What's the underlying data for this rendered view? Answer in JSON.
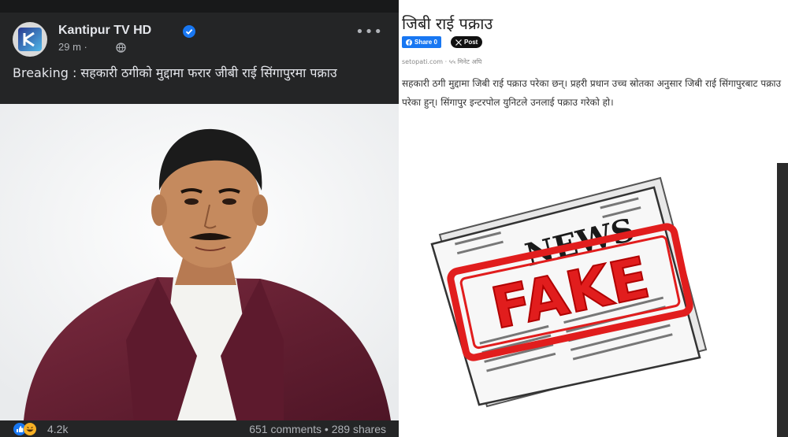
{
  "facebook_post": {
    "page_name": "Kantipur TV HD",
    "timestamp": "29 m · ",
    "more_label": "•••",
    "text": "Breaking : सहकारी ठगीको मुद्दामा फरार जीबी राई सिंगापुरमा पक्राउ",
    "reactions_count": "4.2k",
    "stats": "651 comments • 289 shares"
  },
  "article": {
    "title": "जिबी राई पक्राउ",
    "share_facebook": "Share 0",
    "share_x": "Post",
    "source": "setopati.com · ५५ मिनेट अघि",
    "body": "सहकारी ठगी मुद्दामा जिबी राई पक्राउ परेका छन्। प्रहरी प्रधान उच्च स्रोतका अनुसार जिबी राई सिंगापुरबाट पक्राउ परेका हुन्। सिंगापुर इन्टरपोल युनिटले उनलाई पक्राउ गरेको हो।"
  },
  "graphic": {
    "newspaper_headline": "NEWS",
    "stamp_text": "FAKE"
  },
  "colors": {
    "facebook_dark": "#242526",
    "facebook_blue": "#1877f2",
    "stamp_red": "#e11d1d"
  },
  "icons": [
    "kantipur-logo-icon",
    "verified-badge-icon",
    "globe-icon",
    "like-reaction-icon",
    "haha-reaction-icon",
    "facebook-f-icon",
    "x-logo-icon"
  ]
}
